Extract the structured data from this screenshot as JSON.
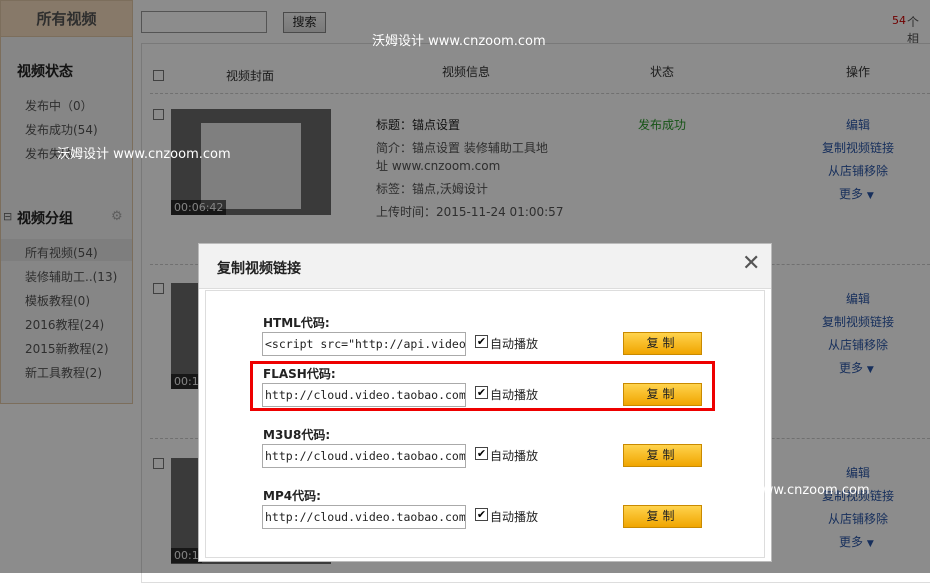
{
  "sidebar": {
    "title": "所有视频",
    "status_heading": "视频状态",
    "status_items": [
      "发布中（0）",
      "发布成功(54)",
      "发布失败"
    ],
    "group_heading": "视频分组",
    "group_items": [
      "所有视频(54)",
      "装修辅助工..(13)",
      "模板教程(0)",
      "2016教程(24)",
      "2015新教程(2)",
      "新工具教程(2)"
    ]
  },
  "top": {
    "search_button": "搜索",
    "count_num": "54",
    "count_unit": "个相"
  },
  "table": {
    "headers": [
      "视频封面",
      "视频信息",
      "状态",
      "操作"
    ],
    "rows": [
      {
        "duration": "00:06:42",
        "title": "标题：锚点设置",
        "intro_line1": "简介：锚点设置 装修辅助工具地",
        "intro_line2": "址 www.cnzoom.com",
        "tags": "标签：锚点,沃姆设计",
        "upload": "上传时间：2015-11-24 01:00:57",
        "status": "发布成功"
      }
    ],
    "row2_duration": "00:1",
    "row3_duration": "00:1",
    "actions": [
      "编辑",
      "复制视频链接",
      "从店铺移除",
      "更多"
    ]
  },
  "dialog": {
    "title": "复制视频链接",
    "close": "✕",
    "rows": [
      {
        "label": "HTML代码:",
        "value": "<script src=\"http://api.video.taobao",
        "auto": "自动播放",
        "button": "复制"
      },
      {
        "label": "FLASH代码:",
        "value": "http://cloud.video.taobao.com/play/",
        "auto": "自动播放",
        "button": "复制"
      },
      {
        "label": "M3U8代码:",
        "value": "http://cloud.video.taobao.com/play/",
        "auto": "自动播放",
        "button": "复制"
      },
      {
        "label": "MP4代码:",
        "value": "http://cloud.video.taobao.com/play/",
        "auto": "自动播放",
        "button": "复制"
      }
    ]
  },
  "watermarks": {
    "wm1": "沃姆设计   www.cnzoom.com",
    "wm2": "沃姆设计   www.cnzoom.com",
    "wm3": "沃姆设计   www.cnzoom.com"
  },
  "colors": {
    "accent": "#f0a500",
    "highlight": "#ee0000",
    "link": "#2b57a8",
    "success": "#2a9a2a"
  }
}
